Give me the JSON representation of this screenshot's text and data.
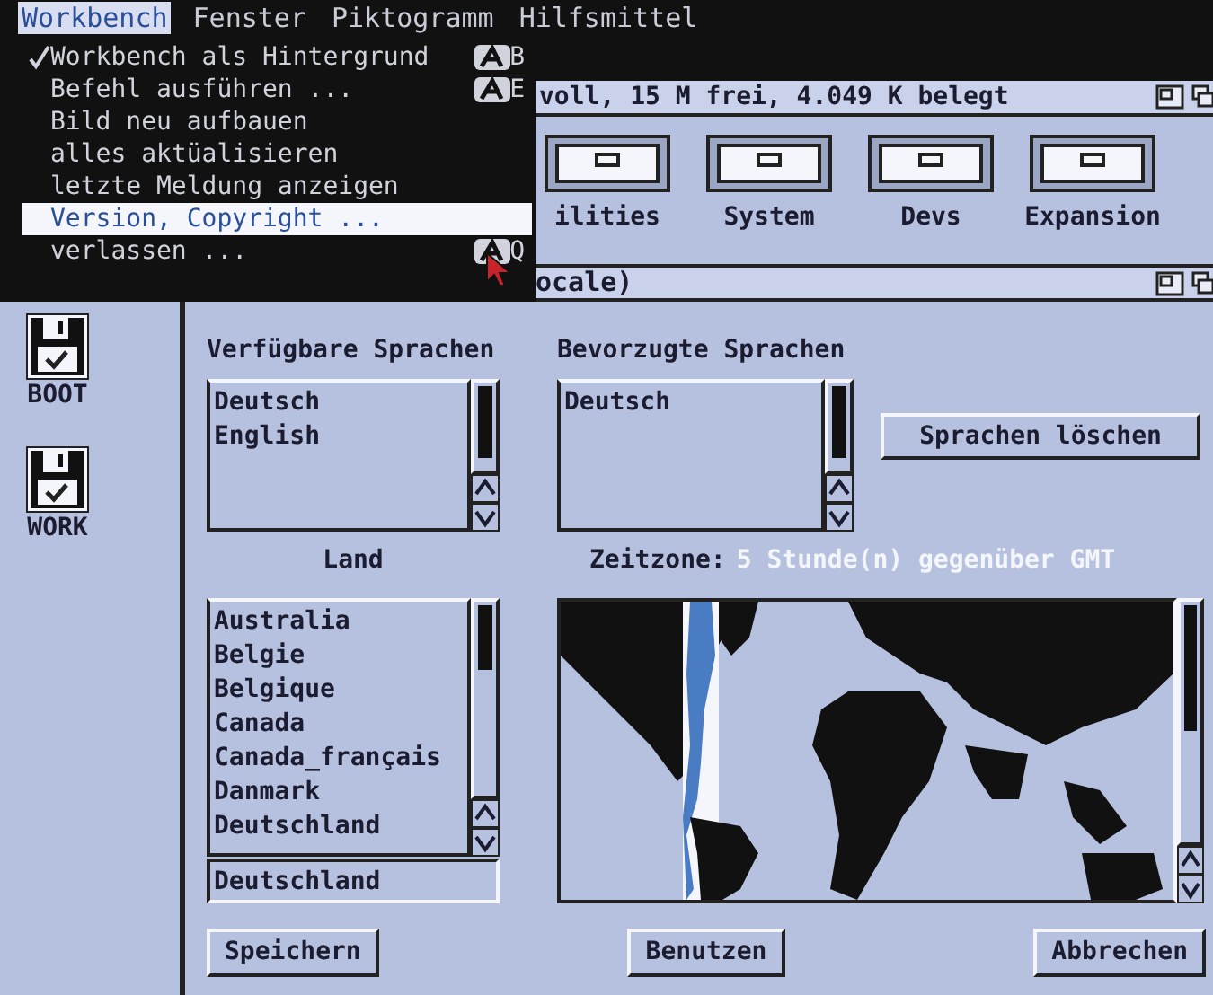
{
  "menu_bar": [
    {
      "label": "Workbench",
      "selected": true
    },
    {
      "label": "Fenster",
      "selected": false
    },
    {
      "label": "Piktogramm",
      "selected": false
    },
    {
      "label": "Hilfsmittel",
      "selected": false
    }
  ],
  "menu": {
    "items": [
      {
        "label": "Workbench als Hintergrund",
        "checked": true,
        "selected": false,
        "shortcut": "B"
      },
      {
        "label": "Befehl ausführen ...",
        "checked": false,
        "selected": false,
        "shortcut": "E"
      },
      {
        "label": "Bild neu aufbauen",
        "checked": false,
        "selected": false
      },
      {
        "label": "alles aktüalisieren",
        "checked": false,
        "selected": false
      },
      {
        "label": "letzte Meldung anzeigen",
        "checked": false,
        "selected": false
      },
      {
        "label": "Version, Copyright ...",
        "checked": false,
        "selected": true
      },
      {
        "label": "verlassen ...",
        "checked": false,
        "selected": false,
        "shortcut": "Q"
      }
    ]
  },
  "disk_window": {
    "title": "voll, 15 M frei, 4.049 K belegt",
    "drawers": [
      {
        "label": "ilities"
      },
      {
        "label": "System"
      },
      {
        "label": "Devs"
      },
      {
        "label": "Expansion"
      }
    ]
  },
  "locale_window": {
    "title": "ocale)"
  },
  "desktop_icons": [
    {
      "label": "BOOT"
    },
    {
      "label": "WORK"
    }
  ],
  "available_languages": {
    "heading": "Verfügbare Sprachen",
    "items": [
      "Deutsch",
      "English"
    ]
  },
  "preferred_languages": {
    "heading": "Bevorzugte Sprachen",
    "items": [
      "Deutsch"
    ]
  },
  "clear_button": "Sprachen löschen",
  "country": {
    "heading": "Land",
    "items": [
      "Australia",
      "Belgie",
      "Belgique",
      "Canada",
      "Canada_français",
      "Danmark",
      "Deutschland"
    ],
    "value": "Deutschland"
  },
  "timezone": {
    "label": "Zeitzone:",
    "value": "5 Stunde(n) gegenüber GMT"
  },
  "buttons": [
    "Speichern",
    "Benutzen",
    "Abbrechen"
  ]
}
